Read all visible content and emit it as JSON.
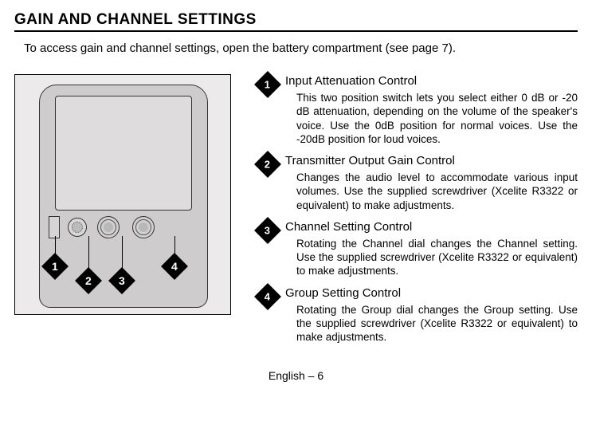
{
  "heading": "GAIN AND CHANNEL SETTINGS",
  "intro": "To access gain and channel settings, open the battery compartment (see page 7).",
  "callouts": {
    "n1": "1",
    "n2": "2",
    "n3": "3",
    "n4": "4"
  },
  "items": [
    {
      "num": "1",
      "title": "Input Attenuation Control",
      "desc": "This two position switch lets you select either 0 dB or -20 dB attenuation, depending on the volume of the speaker's voice. Use the 0dB position for normal voices. Use the -20dB position for loud voices."
    },
    {
      "num": "2",
      "title": "Transmitter Output Gain Control",
      "desc": "Changes the audio level to accommodate various input volumes. Use the supplied screwdriver (Xcelite R3322 or equivalent) to make adjustments."
    },
    {
      "num": "3",
      "title": "Channel Setting Control",
      "desc": "Rotating the Channel dial changes the Channel setting. Use the supplied screwdriver (Xcelite R3322 or equivalent) to make adjustments."
    },
    {
      "num": "4",
      "title": "Group Setting Control",
      "desc": "Rotating the Group dial changes the Group setting. Use the supplied screwdriver (Xcelite R3322 or equivalent) to make adjustments."
    }
  ],
  "footer": "English – 6"
}
